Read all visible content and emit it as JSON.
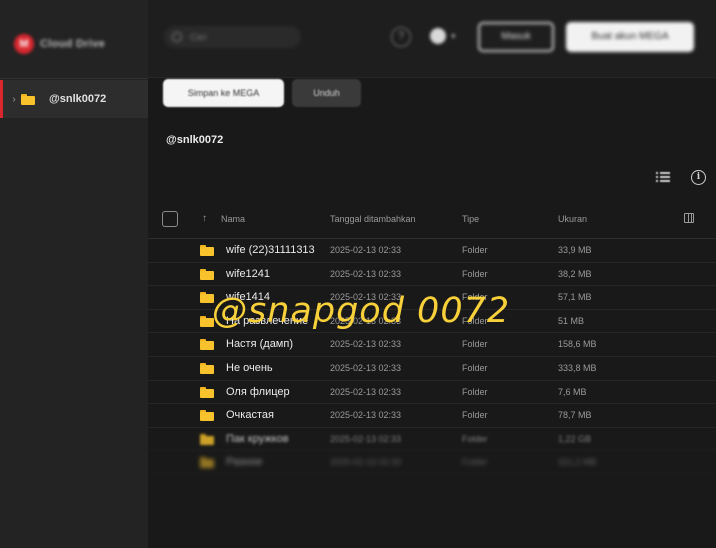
{
  "sidebar": {
    "logo_text": "Cloud Drive",
    "items": [
      {
        "label": "@snlk0072"
      }
    ]
  },
  "header": {
    "search_placeholder": "Cari",
    "login_label": "Masuk",
    "signup_label": "Buat akun MEGA"
  },
  "toolbar": {
    "save_label": "Simpan ke MEGA",
    "download_label": "Unduh"
  },
  "breadcrumb": "@snlk0072",
  "table": {
    "headers": {
      "name": "Nama",
      "date": "Tanggal ditambahkan",
      "type": "Tipe",
      "size": "Ukuran"
    },
    "rows": [
      {
        "name": "wife (22)31111313",
        "date": "2025-02-13 02:33",
        "type": "Folder",
        "size": "33,9 MB"
      },
      {
        "name": "wife1241",
        "date": "2025-02-13 02:33",
        "type": "Folder",
        "size": "38,2 MB"
      },
      {
        "name": "wife1414",
        "date": "2025-02-13 02:33",
        "type": "Folder",
        "size": "57,1 MB"
      },
      {
        "name": "На развлечение",
        "date": "2025-02-13 02:33",
        "type": "Folder",
        "size": "51 MB"
      },
      {
        "name": "Настя (дамп)",
        "date": "2025-02-13 02:33",
        "type": "Folder",
        "size": "158,6 MB"
      },
      {
        "name": "Не очень",
        "date": "2025-02-13 02:33",
        "type": "Folder",
        "size": "333,8 MB"
      },
      {
        "name": "Оля флицер",
        "date": "2025-02-13 02:33",
        "type": "Folder",
        "size": "7,6 MB"
      },
      {
        "name": "Очкастая",
        "date": "2025-02-13 02:33",
        "type": "Folder",
        "size": "78,7 MB"
      },
      {
        "name": "Пак кружков",
        "date": "2025-02-13 02:33",
        "type": "Folder",
        "size": "1,22 GB"
      },
      {
        "name": "Разное",
        "date": "2025-02-13 02:33",
        "type": "Folder",
        "size": "321,2 MB"
      }
    ]
  },
  "watermark": "@snapgod 0072",
  "colors": {
    "accent": "#d9272e",
    "folder": "#f7c22b",
    "watermark": "#f7d03a",
    "background": "#191919"
  }
}
